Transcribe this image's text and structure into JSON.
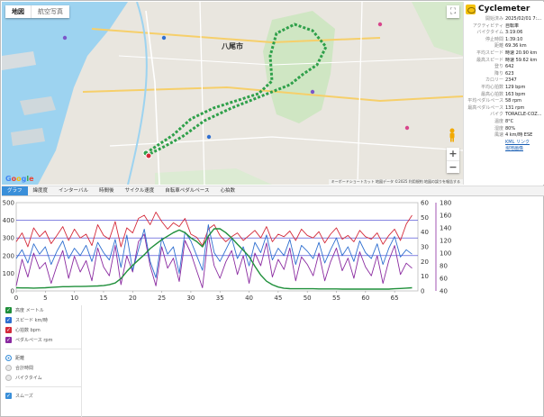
{
  "map": {
    "tabs": [
      "地図",
      "航空写真"
    ],
    "city_label": "八尾市",
    "google": "Google",
    "attribution": "キーボードショートカット  地図データ ©2025  利用規約  地図の誤りを報告する"
  },
  "info": {
    "app_title": "Cyclemeter",
    "rows": [
      {
        "k": "開始済み",
        "v": "2025/02/01 7:..."
      },
      {
        "k": "アクティビティ",
        "v": "自転車"
      },
      {
        "k": "バイクタイム",
        "v": "3:19:06"
      },
      {
        "k": "停止時間",
        "v": "1:39:10"
      },
      {
        "k": "距離",
        "v": "69.36 km"
      },
      {
        "k": "平均スピード",
        "v": "時速 20.90 km"
      },
      {
        "k": "最高スピード",
        "v": "時速 59.62 km"
      },
      {
        "k": "登り",
        "v": "642"
      },
      {
        "k": "降り",
        "v": "623"
      },
      {
        "k": "カロリー",
        "v": "2347"
      },
      {
        "k": "平均心拍数",
        "v": "129 bpm"
      },
      {
        "k": "最高心拍数",
        "v": "163 bpm"
      },
      {
        "k": "平均ペダルペース",
        "v": "58 rpm"
      },
      {
        "k": "最高ペダルペース",
        "v": "131 rpm"
      },
      {
        "k": "バイク",
        "v": "TORACLE-COZ..."
      },
      {
        "k": "温度",
        "v": "8°C"
      },
      {
        "k": "湿度",
        "v": "80%"
      },
      {
        "k": "風速",
        "v": "4 km/時 ESE"
      },
      {
        "k": "",
        "v": "KML リンク"
      },
      {
        "k": "",
        "v": "現地画像"
      }
    ]
  },
  "tabs": {
    "items": [
      "グラフ",
      "緯度度",
      "インターバル",
      "時間後",
      "サイクル速度",
      "自転車ペダルペース",
      "心拍数"
    ],
    "active_index": 0
  },
  "controls": {
    "series": [
      {
        "label": "高度  メートル",
        "color": "#1f8f3a"
      },
      {
        "label": "スピード  km/時",
        "color": "#2f6fd0"
      },
      {
        "label": "心拍数  bpm",
        "color": "#d42a3a"
      },
      {
        "label": "ペダルペース  rpm",
        "color": "#8a2aa0"
      }
    ],
    "xaxis_options": [
      "距離",
      "合計時間",
      "バイクタイム"
    ],
    "xaxis_selected": 0,
    "smooth_label": "スムーズ"
  },
  "chart_data": {
    "type": "line",
    "x": [
      0,
      1,
      2,
      3,
      4,
      5,
      6,
      7,
      8,
      9,
      10,
      11,
      12,
      13,
      14,
      15,
      16,
      17,
      18,
      19,
      20,
      21,
      22,
      23,
      24,
      25,
      26,
      27,
      28,
      29,
      30,
      31,
      32,
      33,
      34,
      35,
      36,
      37,
      38,
      39,
      40,
      41,
      42,
      43,
      44,
      45,
      46,
      47,
      48,
      49,
      50,
      51,
      52,
      53,
      54,
      55,
      56,
      57,
      58,
      59,
      60,
      61,
      62,
      63,
      64,
      65,
      66,
      67,
      68
    ],
    "x_ticks": [
      0,
      5,
      10,
      15,
      20,
      25,
      30,
      35,
      40,
      45,
      50,
      55,
      60,
      65
    ],
    "xlim": [
      0,
      69
    ],
    "y_ticks_left": [
      0,
      100,
      200,
      300,
      400,
      500
    ],
    "ylim_left": [
      0,
      500
    ],
    "y_ticks_right1": [
      0,
      10,
      20,
      30,
      40,
      50,
      60
    ],
    "ylim_right1": [
      0,
      60
    ],
    "y_ticks_right2": [
      40,
      60,
      80,
      100,
      120,
      140,
      160,
      180
    ],
    "ylim_right2": [
      40,
      180
    ],
    "grid_y_left": [
      200,
      300,
      400
    ],
    "series": [
      {
        "color": "#1f8f3a",
        "axis": "left",
        "values": [
          18,
          17,
          17,
          16,
          17,
          18,
          20,
          22,
          24,
          24,
          25,
          25,
          26,
          27,
          28,
          30,
          35,
          45,
          70,
          110,
          145,
          175,
          205,
          240,
          265,
          290,
          310,
          330,
          345,
          330,
          300,
          280,
          250,
          310,
          352,
          352,
          330,
          300,
          265,
          230,
          195,
          140,
          90,
          55,
          35,
          22,
          15,
          13,
          12,
          12,
          12,
          12,
          11,
          11,
          11,
          11,
          10,
          10,
          10,
          10,
          10,
          10,
          10,
          10,
          10,
          12,
          14,
          16,
          18
        ]
      },
      {
        "color": "#2f6fd0",
        "axis": "right1",
        "values": [
          22,
          28,
          19,
          32,
          25,
          30,
          18,
          27,
          34,
          22,
          29,
          24,
          31,
          20,
          33,
          26,
          21,
          35,
          16,
          38,
          14,
          28,
          42,
          20,
          9,
          36,
          25,
          30,
          12,
          40,
          34,
          24,
          14,
          45,
          26,
          20,
          28,
          36,
          22,
          30,
          17,
          33,
          26,
          38,
          21,
          29,
          24,
          35,
          18,
          31,
          27,
          22,
          33,
          19,
          28,
          36,
          24,
          30,
          20,
          34,
          26,
          22,
          32,
          18,
          29,
          37,
          23,
          28,
          25
        ]
      },
      {
        "color": "#d42a3a",
        "axis": "right2",
        "values": [
          118,
          132,
          110,
          140,
          126,
          135,
          115,
          128,
          142,
          120,
          138,
          124,
          130,
          112,
          145,
          128,
          122,
          150,
          110,
          140,
          132,
          155,
          160,
          145,
          165,
          150,
          138,
          148,
          142,
          155,
          130,
          125,
          112,
          138,
          145,
          128,
          118,
          126,
          132,
          120,
          128,
          136,
          124,
          142,
          118,
          130,
          126,
          135,
          120,
          138,
          128,
          124,
          134,
          116,
          130,
          140,
          122,
          128,
          118,
          136,
          126,
          122,
          132,
          114,
          128,
          138,
          120,
          146,
          160
        ]
      },
      {
        "color": "#8a2aa0",
        "axis": "right2",
        "values": [
          48,
          90,
          62,
          100,
          75,
          85,
          52,
          80,
          104,
          60,
          95,
          70,
          88,
          56,
          108,
          78,
          64,
          112,
          50,
          96,
          70,
          118,
          130,
          80,
          48,
          110,
          76,
          92,
          55,
          120,
          100,
          72,
          45,
          128,
          80,
          60,
          86,
          104,
          66,
          96,
          52,
          100,
          80,
          116,
          62,
          90,
          74,
          108,
          56,
          94,
          82,
          64,
          100,
          56,
          86,
          108,
          72,
          92,
          60,
          102,
          78,
          64,
          96,
          52,
          88,
          112,
          66,
          84,
          76
        ]
      }
    ]
  }
}
